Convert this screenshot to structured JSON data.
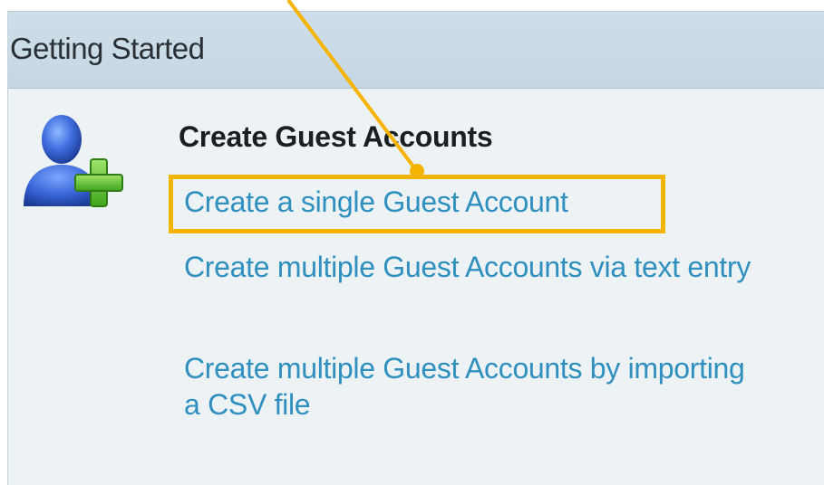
{
  "panel": {
    "title": "Getting Started"
  },
  "section": {
    "heading": "Create Guest Accounts",
    "icon": "user-add-icon"
  },
  "links": {
    "single": "Create a single Guest Account",
    "multiple_text": "Create multiple Guest Accounts via text entry",
    "multiple_csv": "Create multiple Guest Accounts by importing a CSV file"
  },
  "annotation": {
    "highlight_color": "#f5b400",
    "target": "single"
  },
  "colors": {
    "link": "#2f8fbf",
    "header_bg": "#c9dbe6",
    "panel_bg": "#edf2f4"
  }
}
